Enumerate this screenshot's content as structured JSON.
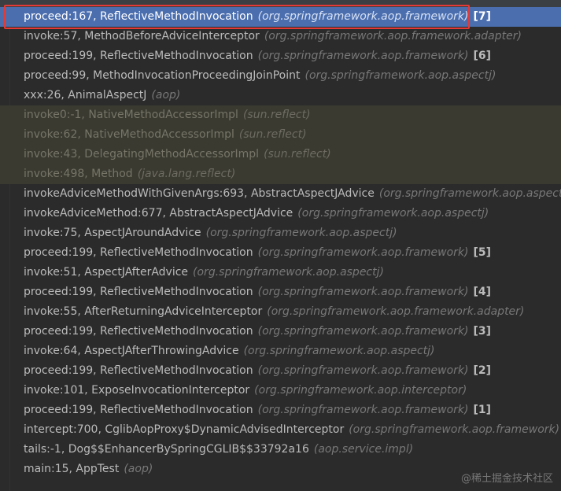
{
  "frames": [
    {
      "method": "proceed:167, ReflectiveMethodInvocation",
      "package": "(org.springframework.aop.framework)",
      "index": "[7]"
    },
    {
      "method": "invoke:57, MethodBeforeAdviceInterceptor",
      "package": "(org.springframework.aop.framework.adapter)",
      "index": ""
    },
    {
      "method": "proceed:199, ReflectiveMethodInvocation",
      "package": "(org.springframework.aop.framework)",
      "index": "[6]"
    },
    {
      "method": "proceed:99, MethodInvocationProceedingJoinPoint",
      "package": "(org.springframework.aop.aspectj)",
      "index": ""
    },
    {
      "method": "xxx:26, AnimalAspectJ",
      "package": "(aop)",
      "index": ""
    },
    {
      "method": "invoke0:-1, NativeMethodAccessorImpl",
      "package": "(sun.reflect)",
      "index": ""
    },
    {
      "method": "invoke:62, NativeMethodAccessorImpl",
      "package": "(sun.reflect)",
      "index": ""
    },
    {
      "method": "invoke:43, DelegatingMethodAccessorImpl",
      "package": "(sun.reflect)",
      "index": ""
    },
    {
      "method": "invoke:498, Method",
      "package": "(java.lang.reflect)",
      "index": ""
    },
    {
      "method": "invokeAdviceMethodWithGivenArgs:693, AbstractAspectJAdvice",
      "package": "(org.springframework.aop.aspectj)",
      "index": ""
    },
    {
      "method": "invokeAdviceMethod:677, AbstractAspectJAdvice",
      "package": "(org.springframework.aop.aspectj)",
      "index": ""
    },
    {
      "method": "invoke:75, AspectJAroundAdvice",
      "package": "(org.springframework.aop.aspectj)",
      "index": ""
    },
    {
      "method": "proceed:199, ReflectiveMethodInvocation",
      "package": "(org.springframework.aop.framework)",
      "index": "[5]"
    },
    {
      "method": "invoke:51, AspectJAfterAdvice",
      "package": "(org.springframework.aop.aspectj)",
      "index": ""
    },
    {
      "method": "proceed:199, ReflectiveMethodInvocation",
      "package": "(org.springframework.aop.framework)",
      "index": "[4]"
    },
    {
      "method": "invoke:55, AfterReturningAdviceInterceptor",
      "package": "(org.springframework.aop.framework.adapter)",
      "index": ""
    },
    {
      "method": "proceed:199, ReflectiveMethodInvocation",
      "package": "(org.springframework.aop.framework)",
      "index": "[3]"
    },
    {
      "method": "invoke:64, AspectJAfterThrowingAdvice",
      "package": "(org.springframework.aop.aspectj)",
      "index": ""
    },
    {
      "method": "proceed:199, ReflectiveMethodInvocation",
      "package": "(org.springframework.aop.framework)",
      "index": "[2]"
    },
    {
      "method": "invoke:101, ExposeInvocationInterceptor",
      "package": "(org.springframework.aop.interceptor)",
      "index": ""
    },
    {
      "method": "proceed:199, ReflectiveMethodInvocation",
      "package": "(org.springframework.aop.framework)",
      "index": "[1]"
    },
    {
      "method": "intercept:700, CglibAopProxy$DynamicAdvisedInterceptor",
      "package": "(org.springframework.aop.framework)",
      "index": ""
    },
    {
      "method": "tails:-1, Dog$$EnhancerBySpringCGLIB$$33792a16",
      "package": "(aop.service.impl)",
      "index": ""
    },
    {
      "method": "main:15, AppTest",
      "package": "(aop)",
      "index": ""
    }
  ],
  "watermark": "@稀土掘金技术社区",
  "colors": {
    "background": "#2b2b2b",
    "selected_row": "#4b6eaf",
    "library_row": "#3a3a31",
    "highlight_border": "#e53935"
  }
}
